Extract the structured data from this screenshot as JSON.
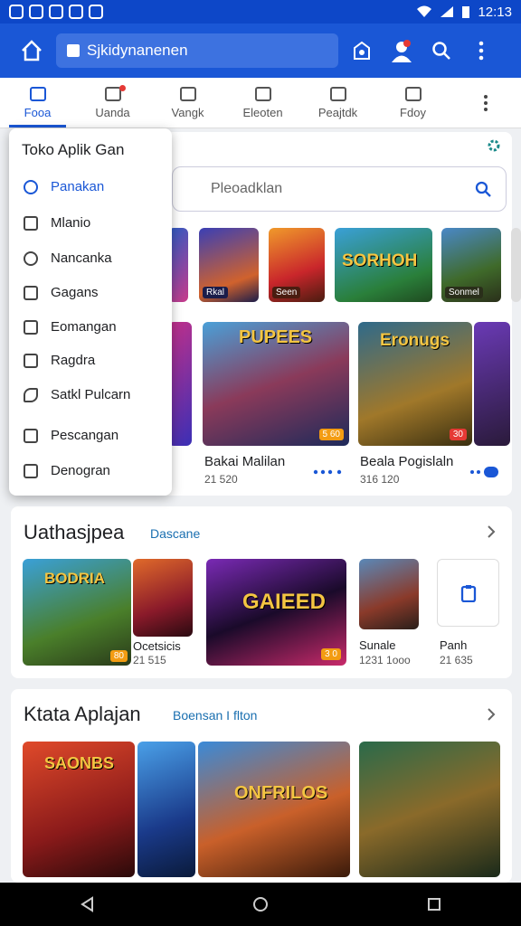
{
  "status": {
    "time": "12:13"
  },
  "appbar": {
    "url_text": "Sjkidynanenen"
  },
  "tabs": [
    {
      "label": "Fooa"
    },
    {
      "label": "Uanda"
    },
    {
      "label": "Vangk"
    },
    {
      "label": "Eleoten"
    },
    {
      "label": "Peajtdk"
    },
    {
      "label": "Fdoy"
    }
  ],
  "drawer": {
    "title": "Toko Aplik Gan",
    "items": [
      {
        "label": "Panakan"
      },
      {
        "label": "Mlanio"
      },
      {
        "label": "Nancanka"
      },
      {
        "label": "Gagans"
      },
      {
        "label": "Eomangan"
      },
      {
        "label": "Ragdra"
      },
      {
        "label": "Satkl Pulcarn"
      },
      {
        "label": "Pescangan"
      },
      {
        "label": "Denogran"
      }
    ]
  },
  "search": {
    "placeholder": "Pleoadklan"
  },
  "top_thumbs": [
    {
      "caption": "Rkal"
    },
    {
      "caption": "Seen"
    },
    {
      "caption": "Sonmel"
    },
    {
      "caption": "SORHOH"
    }
  ],
  "featured": [
    {
      "title": "Bakai Malilan",
      "meta": "21 520",
      "art_text": "PUPEES"
    },
    {
      "title": "Beala Pogislaln",
      "meta": "316 120",
      "art_text": "Eronugs"
    }
  ],
  "section1": {
    "title": "Uathasjpea",
    "link": "Dascane",
    "items": [
      {
        "name": "",
        "meta": "",
        "art_text": "BODRIA"
      },
      {
        "name": "Ocetsicis",
        "meta": "21 515"
      },
      {
        "name": "",
        "meta": "",
        "art_text": "GAIEED"
      },
      {
        "name": "Sunale",
        "meta": "1231 1ooo"
      },
      {
        "name": "Panh",
        "meta": "21 635"
      }
    ]
  },
  "section2": {
    "title": "Ktata Aplajan",
    "link": "Boensan I flton",
    "items": [
      {
        "art_text": "SAONBS"
      },
      {
        "art_text": ""
      },
      {
        "art_text": "ONFRILOS"
      },
      {
        "art_text": ""
      }
    ]
  },
  "colors": {
    "primary": "#1a57d6",
    "status": "#0d47c8",
    "accent": "#f39c12"
  }
}
